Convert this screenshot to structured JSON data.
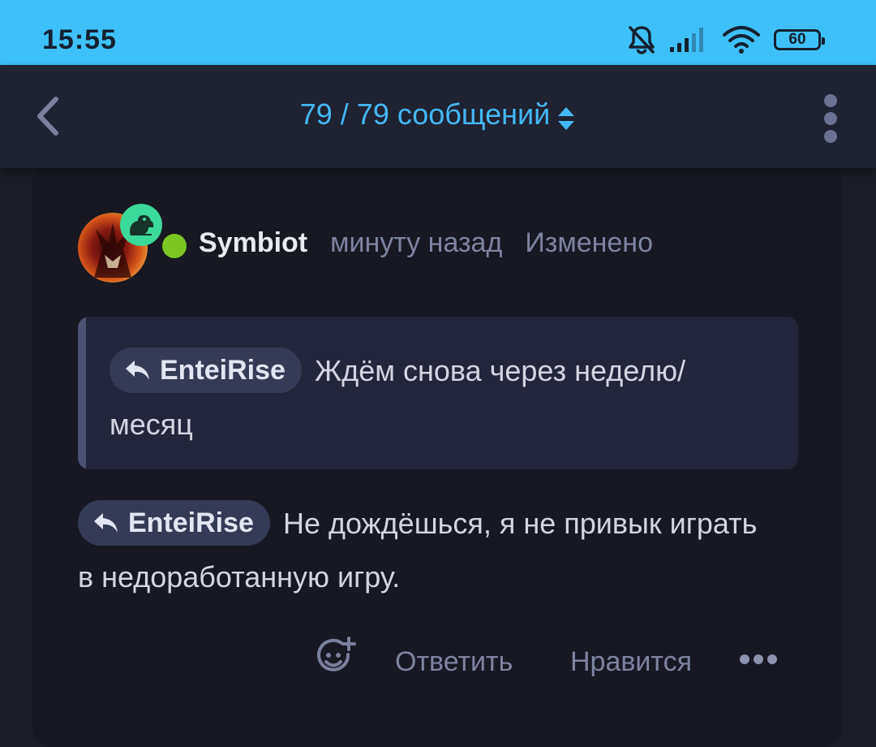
{
  "status_bar": {
    "time": "15:55",
    "battery": "60",
    "icons": [
      "bell-off-icon",
      "signal-icon",
      "wifi-icon",
      "battery-icon"
    ]
  },
  "header": {
    "title": "79 / 79 сообщений",
    "back_icon": "chevron-left-icon",
    "sort_icon": "sort-updown-icon",
    "menu_icon": "more-vertical-icon"
  },
  "post": {
    "author": "Symbiot",
    "timestamp": "минуту назад",
    "edited_label": "Изменено",
    "online": true,
    "badge_icon": "frog-icon",
    "quote": {
      "mention": "EnteiRise",
      "text": "Ждём снова через неделю/ месяц"
    },
    "reply_mention": "EnteiRise",
    "body": "Не дождёшься, я не привык играть в недоработанную игру.",
    "actions": {
      "reply_label": "Ответить",
      "like_label": "Нравится",
      "react_icon": "add-reaction-icon",
      "more_icon": "more-horizontal-icon"
    }
  },
  "colors": {
    "status_bar_bg": "#3ec1fb",
    "accent": "#44b8f6",
    "background": "#1c1d28",
    "card": "#171822",
    "online": "#7cc623",
    "badge": "#3bd99a"
  }
}
